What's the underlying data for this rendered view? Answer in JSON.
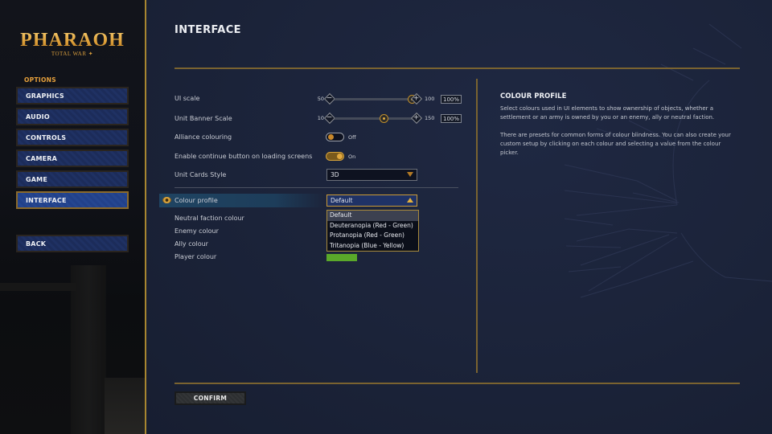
{
  "logo": {
    "title": "PHARAOH",
    "subtitle": "TOTAL WAR"
  },
  "sidebar": {
    "section_label": "OPTIONS",
    "items": [
      {
        "label": "GRAPHICS",
        "active": false
      },
      {
        "label": "AUDIO",
        "active": false
      },
      {
        "label": "CONTROLS",
        "active": false
      },
      {
        "label": "CAMERA",
        "active": false
      },
      {
        "label": "GAME",
        "active": false
      },
      {
        "label": "INTERFACE",
        "active": true
      }
    ],
    "back_label": "BACK"
  },
  "page": {
    "title": "INTERFACE"
  },
  "settings": {
    "ui_scale": {
      "label": "UI scale",
      "min": "50",
      "max": "100",
      "value_text": "100%",
      "fraction": 1.0
    },
    "unit_banner_scale": {
      "label": "Unit Banner Scale",
      "min": "10",
      "max": "150",
      "value_text": "100%",
      "fraction": 0.64
    },
    "alliance_colouring": {
      "label": "Alliance colouring",
      "state": "Off"
    },
    "continue_button": {
      "label": "Enable continue button on loading screens",
      "state": "On"
    },
    "unit_cards_style": {
      "label": "Unit Cards Style",
      "value": "3D"
    },
    "colour_profile": {
      "label": "Colour profile",
      "value": "Default",
      "options": [
        "Default",
        "Deuteranopia (Red - Green)",
        "Protanopia (Red - Green)",
        "Tritanopia (Blue - Yellow)"
      ],
      "selected_index": 0
    },
    "colour_rows": [
      {
        "label": "Neutral faction colour"
      },
      {
        "label": "Enemy colour"
      },
      {
        "label": "Ally colour"
      },
      {
        "label": "Player colour",
        "swatch": "#5aa82a"
      }
    ]
  },
  "info_panel": {
    "title": "COLOUR PROFILE",
    "paragraphs": [
      "Select colours used in UI elements to show ownership of objects, whether a settlement or an army is owned by you or an enemy, ally or neutral faction.",
      "There are presets for common forms of colour blindness. You can also create your custom setup by clicking on each colour and selecting a value from the colour picker."
    ]
  },
  "footer": {
    "confirm_label": "CONFIRM"
  },
  "colors": {
    "accent_gold": "#a88630",
    "active_nav": "#254690",
    "panel_bg": "#1b2339"
  }
}
